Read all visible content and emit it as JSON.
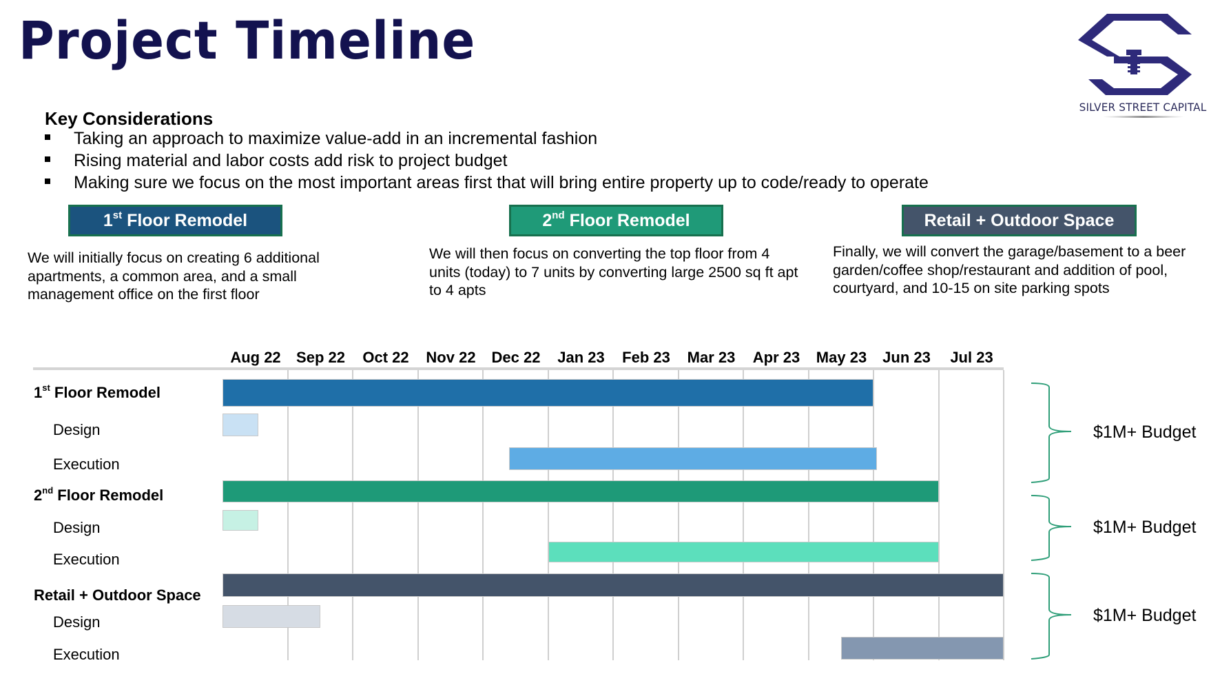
{
  "title": "Project Timeline",
  "logo": {
    "icon": "silver-street-capital-logo-icon",
    "text": "SILVER STREET CAPITAL",
    "color": "#2e2a7a"
  },
  "key_considerations": {
    "heading": "Key Considerations",
    "bullets": [
      "Taking an approach to maximize value-add in an incremental fashion",
      "Rising material and labor costs add risk to project budget",
      "Making sure we focus on the most important areas first that will bring entire property up to code/ready to operate"
    ]
  },
  "phases": [
    {
      "label_num": "1",
      "label_sup": "st",
      "label_rest": " Floor Remodel",
      "color": "#1b537e",
      "border": "#17704e",
      "description": "We will initially focus on creating 6 additional apartments, a common area, and a small management office on the first floor"
    },
    {
      "label_num": "2",
      "label_sup": "nd",
      "label_rest": " Floor Remodel",
      "color": "#1f9a78",
      "border": "#17704e",
      "description": "We will then focus on converting the top floor from 4 units (today) to 7 units by converting large 2500 sq ft apt to 4 apts"
    },
    {
      "label_num": "",
      "label_sup": "",
      "label_rest": "Retail + Outdoor Space",
      "color": "#44546a",
      "border": "#17704e",
      "description": "Finally, we will convert the garage/basement to a beer garden/coffee shop/restaurant and addition of pool, courtyard, and 10-15 on site parking spots"
    }
  ],
  "chart_data": {
    "type": "gantt",
    "title": "",
    "x_unit": "months since Aug 2022 start",
    "x_range": [
      0,
      12
    ],
    "categories": [
      "Aug 22",
      "Sep 22",
      "Oct 22",
      "Nov 22",
      "Dec 22",
      "Jan 23",
      "Feb 23",
      "Mar 23",
      "Apr 23",
      "May 23",
      "Jun 23",
      "Jul 23"
    ],
    "grid": true,
    "groups": [
      {
        "name_num": "1",
        "name_sup": "st",
        "name_rest": " Floor Remodel",
        "budget": "$1M+ Budget",
        "tasks": [
          {
            "name": "1st Floor Remodel",
            "label": "",
            "start": 0,
            "end": 10,
            "color": "#1f6fa8",
            "level": "main"
          },
          {
            "name": "Design",
            "label": "Design",
            "start": 0,
            "end": 0.55,
            "color": "#c9e1f4",
            "level": "sub"
          },
          {
            "name": "Execution",
            "label": "Execution",
            "start": 4.4,
            "end": 10.05,
            "color": "#5eace4",
            "level": "sub"
          }
        ]
      },
      {
        "name_num": "2",
        "name_sup": "nd",
        "name_rest": " Floor Remodel",
        "budget": "$1M+ Budget",
        "tasks": [
          {
            "name": "2nd Floor Remodel",
            "label": "",
            "start": 0,
            "end": 11,
            "color": "#1e9a78",
            "level": "main"
          },
          {
            "name": "Design",
            "label": "Design",
            "start": 0,
            "end": 0.55,
            "color": "#c6f1e4",
            "level": "sub"
          },
          {
            "name": "Execution",
            "label": "Execution",
            "start": 5,
            "end": 11,
            "color": "#5cdfbc",
            "level": "sub"
          }
        ]
      },
      {
        "name_num": "",
        "name_sup": "",
        "name_rest": "Retail + Outdoor Space",
        "budget": "$1M+ Budget",
        "tasks": [
          {
            "name": "Retail + Outdoor Space",
            "label": "",
            "start": 0,
            "end": 12,
            "color": "#44546a",
            "level": "main"
          },
          {
            "name": "Design",
            "label": "Design",
            "start": 0,
            "end": 1.5,
            "color": "#d6dce4",
            "level": "sub"
          },
          {
            "name": "Execution",
            "label": "Execution",
            "start": 9.5,
            "end": 12,
            "color": "#8497b0",
            "level": "sub"
          }
        ]
      }
    ],
    "brace_color": "#2e9e78"
  }
}
